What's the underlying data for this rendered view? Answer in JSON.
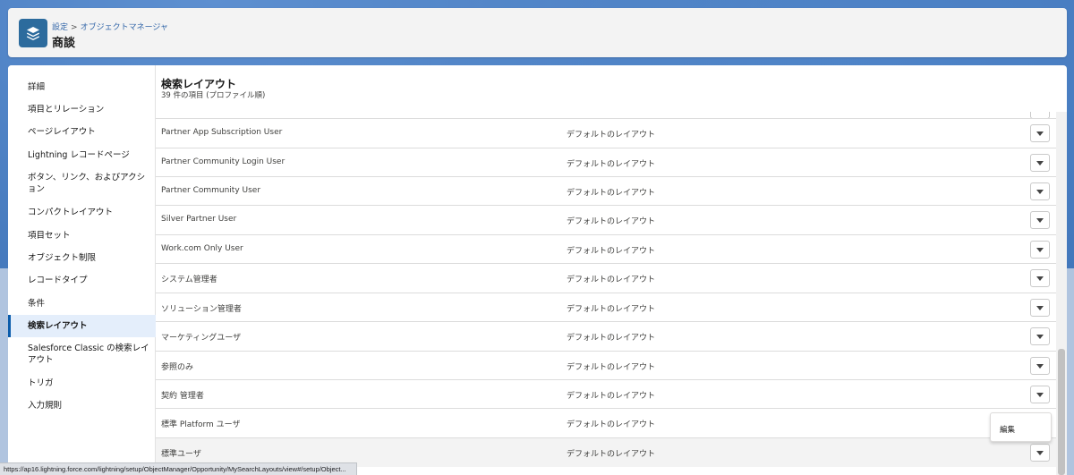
{
  "header": {
    "breadcrumb": [
      "設定",
      "オブジェクトマネージャ"
    ],
    "breadcrumb_separator": ">",
    "title": "商談"
  },
  "sidebar": {
    "items": [
      {
        "label": "詳細"
      },
      {
        "label": "項目とリレーション"
      },
      {
        "label": "ページレイアウト"
      },
      {
        "label": "Lightning レコードページ"
      },
      {
        "label": "ボタン、リンク、およびアクション"
      },
      {
        "label": "コンパクトレイアウト"
      },
      {
        "label": "項目セット"
      },
      {
        "label": "オブジェクト制限"
      },
      {
        "label": "レコードタイプ"
      },
      {
        "label": "条件"
      },
      {
        "label": "検索レイアウト",
        "active": true
      },
      {
        "label": "Salesforce Classic の検索レイアウト"
      },
      {
        "label": "トリガ"
      },
      {
        "label": "入力規則"
      }
    ]
  },
  "content": {
    "title": "検索レイアウト",
    "subtitle": "39 件の項目 (プロファイル順)",
    "rows": [
      {
        "name": "Partner App Subscription User",
        "layout": "デフォルトのレイアウト"
      },
      {
        "name": "Partner Community Login User",
        "layout": "デフォルトのレイアウト"
      },
      {
        "name": "Partner Community User",
        "layout": "デフォルトのレイアウト"
      },
      {
        "name": "Silver Partner User",
        "layout": "デフォルトのレイアウト"
      },
      {
        "name": "Work.com Only User",
        "layout": "デフォルトのレイアウト"
      },
      {
        "name": "システム管理者",
        "layout": "デフォルトのレイアウト"
      },
      {
        "name": "ソリューション管理者",
        "layout": "デフォルトのレイアウト"
      },
      {
        "name": "マーケティングユーザ",
        "layout": "デフォルトのレイアウト"
      },
      {
        "name": "参照のみ",
        "layout": "デフォルトのレイアウト"
      },
      {
        "name": "契約 管理者",
        "layout": "デフォルトのレイアウト"
      },
      {
        "name": "標準 Platform ユーザ",
        "layout": "デフォルトのレイアウト"
      },
      {
        "name": "標準ユーザ",
        "layout": "デフォルトのレイアウト",
        "hover": true
      }
    ],
    "row_menu_icon": "chevron-down-icon",
    "dropdown_items": [
      "編集"
    ]
  },
  "status_bar": {
    "url": "https://ap16.lightning.force.com/lightning/setup/ObjectManager/Opportunity/MySearchLayouts/view#/setup/Object..."
  },
  "colors": {
    "brand_blue": "#0b5cab",
    "object_icon": "#2c6b9d",
    "link": "#3467a9",
    "background": "#3f74b8"
  }
}
